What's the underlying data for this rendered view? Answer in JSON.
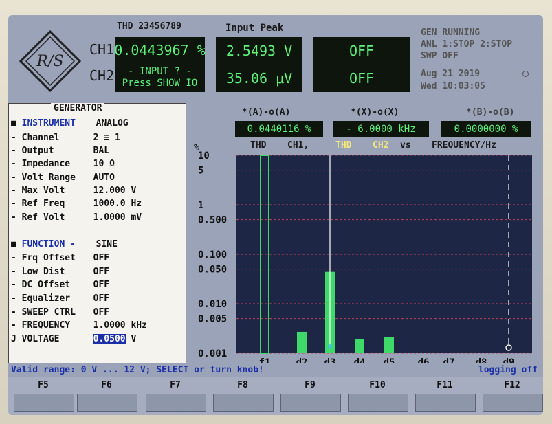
{
  "header": {
    "thd_title": "THD 23456789",
    "input_title": "Input Peak",
    "ch1_label": "CH1",
    "ch2_label": "CH2",
    "ch1_thd": "0.0443967 %",
    "ch2_input_line1": "- INPUT ? -",
    "ch2_input_line2": "Press SHOW IO",
    "ch1_peak": "2.5493  V",
    "ch2_peak": "35.06 μV",
    "off1": "OFF",
    "off2": "OFF",
    "status1": "GEN RUNNING",
    "status2": "ANL 1:STOP 2:STOP",
    "status3": "SWP OFF",
    "date": "Aug 21 2019",
    "time": "Wed 10:03:05",
    "logo": "R/S"
  },
  "generator": {
    "title": "GENERATOR",
    "rows": [
      {
        "k": "INSTRUMENT",
        "v": "ANALOG",
        "mark": "■"
      },
      {
        "k": "Channel",
        "v": "2 ≡ 1",
        "mark": "-"
      },
      {
        "k": "Output",
        "v": "BAL",
        "mark": "-"
      },
      {
        "k": "Impedance",
        "v": "10 Ω",
        "mark": "-"
      },
      {
        "k": "Volt Range",
        "v": "AUTO",
        "mark": "-"
      },
      {
        "k": "Max Volt",
        "v": "12.000 V",
        "mark": "-"
      },
      {
        "k": "Ref Freq",
        "v": "1000.0 Hz",
        "mark": "-"
      },
      {
        "k": "Ref Volt",
        "v": "1.0000 mV",
        "mark": "-"
      },
      {
        "k": "FUNCTION  -",
        "v": "SINE",
        "mark": "■"
      },
      {
        "k": "Frq Offset",
        "v": "OFF",
        "mark": "-"
      },
      {
        "k": "Low Dist",
        "v": "OFF",
        "mark": "-"
      },
      {
        "k": "DC Offset",
        "v": "OFF",
        "mark": "-"
      },
      {
        "k": "Equalizer",
        "v": "OFF",
        "mark": "-"
      },
      {
        "k": "SWEEP CTRL",
        "v": "OFF",
        "mark": "-"
      },
      {
        "k": "FREQUENCY",
        "v": "1.0000 kHz",
        "mark": "-"
      },
      {
        "k": "VOLTAGE",
        "v": "0.0500",
        "unit": "V",
        "mark": "J"
      }
    ]
  },
  "graph": {
    "cursor_a_label": "*(A)-o(A)",
    "cursor_x_label": "*(X)-o(X)",
    "cursor_b_label": "*(B)-o(B)",
    "cursor_a_value": "0.0440116 %",
    "cursor_x_value": "- 6.0000 kHz",
    "cursor_b_value": "0.0000000 %",
    "unit": "%",
    "legend_thd1": "THD",
    "legend_ch1": "CH1,",
    "legend_thd2": "THD",
    "legend_ch2": "CH2",
    "legend_vs": "vs",
    "legend_freq": "FREQUENCY/Hz",
    "y_ticks": [
      "10",
      "5",
      "1",
      "0.500",
      "0.100",
      "0.050",
      "0.010",
      "0.005",
      "0.001"
    ],
    "x_ticks": [
      "f1",
      "d2",
      "d3",
      "d4",
      "d5",
      "d6",
      "d7",
      "d8",
      "d9"
    ]
  },
  "chart_data": {
    "type": "bar",
    "categories": [
      "f1",
      "d2",
      "d3",
      "d4",
      "d5",
      "d6",
      "d7",
      "d8",
      "d9"
    ],
    "values": [
      10,
      0.0027,
      0.044,
      0.0019,
      0.0021,
      null,
      null,
      null,
      null
    ],
    "ylabel": "%",
    "ylim": [
      0.001,
      10
    ],
    "log_scale": true,
    "grid": true
  },
  "status": {
    "valid_range": "Valid range: 0 V ... 12  V; SELECT or turn knob!",
    "logging": "logging off"
  },
  "fkeys": [
    "F5",
    "F6",
    "F7",
    "F8",
    "F9",
    "F10",
    "F11",
    "F12"
  ],
  "colors": {
    "lcd_bg": "#0d150d",
    "lcd_text": "#5df27a",
    "bar": "#3fd96a",
    "plot_bg": "#1d2745",
    "accent_blue": "#1a2fa8"
  }
}
